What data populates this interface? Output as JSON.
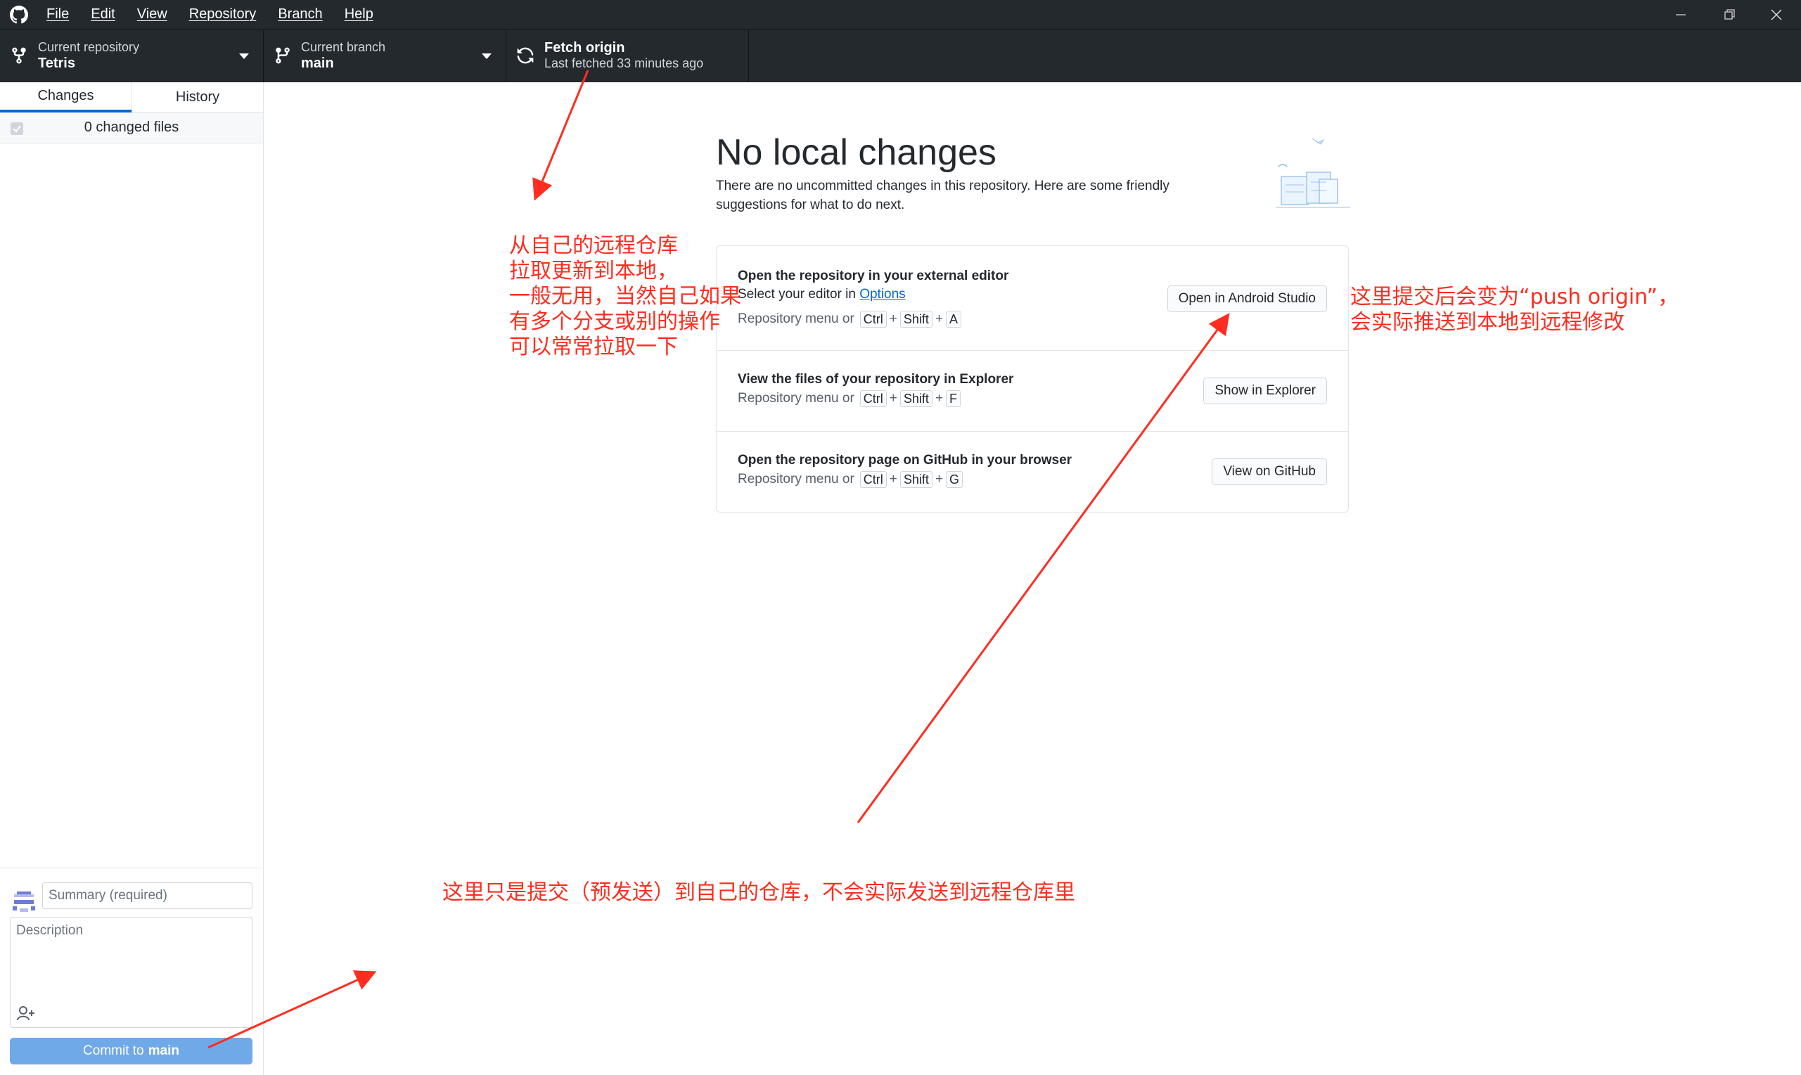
{
  "titlebar": {
    "menus": [
      "File",
      "Edit",
      "View",
      "Repository",
      "Branch",
      "Help"
    ]
  },
  "toolbar": {
    "repository": {
      "label": "Current repository",
      "value": "Tetris"
    },
    "branch": {
      "label": "Current branch",
      "value": "main"
    },
    "fetch": {
      "label": "Fetch origin",
      "value": "Last fetched 33 minutes ago"
    }
  },
  "sidebar": {
    "tabs": [
      "Changes",
      "History"
    ],
    "active_tab": "Changes",
    "changed_files": "0 changed files",
    "summary_placeholder": "Summary (required)",
    "description_placeholder": "Description",
    "commit_prefix": "Commit to",
    "commit_branch": "main"
  },
  "main": {
    "title": "No local changes",
    "subtitle": "There are no uncommitted changes in this repository. Here are some friendly suggestions for what to do next.",
    "suggestions": [
      {
        "title": "Open the repository in your external editor",
        "subtitle_prefix": "Select your editor in",
        "subtitle_link": "Options",
        "keys_prefix": "Repository menu or",
        "keys": [
          "Ctrl",
          "Shift",
          "A"
        ],
        "button": "Open in Android Studio"
      },
      {
        "title": "View the files of your repository in Explorer",
        "keys_prefix": "Repository menu or",
        "keys": [
          "Ctrl",
          "Shift",
          "F"
        ],
        "button": "Show in Explorer"
      },
      {
        "title": "Open the repository page on GitHub in your browser",
        "keys_prefix": "Repository menu or",
        "keys": [
          "Ctrl",
          "Shift",
          "G"
        ],
        "button": "View on GitHub"
      }
    ]
  },
  "annotations": {
    "fetch_note": [
      "从自己的远程仓库",
      "拉取更新到本地，",
      "一般无用，当然自己如果",
      "有多个分支或别的操作",
      "可以常常拉取一下"
    ],
    "push_note": [
      "这里提交后会变为“push origin”，",
      "会实际推送到本地到远程修改"
    ],
    "commit_note": "这里只是提交（预发送）到自己的仓库，不会实际发送到远程仓库里",
    "color": "#ff2d1f"
  },
  "colors": {
    "titlebar": "#24292e",
    "accent": "#0366d6",
    "commit_button": "#6fa9e8"
  }
}
